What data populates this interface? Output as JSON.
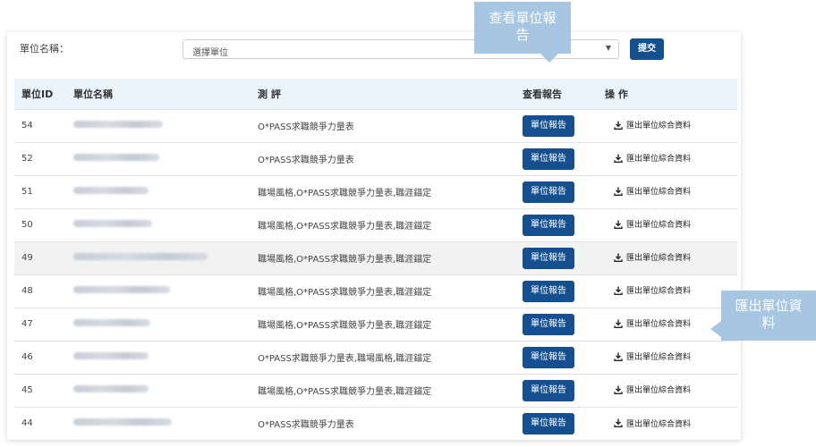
{
  "filter": {
    "label": "單位名稱：",
    "select_value": "選擇單位",
    "submit_label": "提交"
  },
  "table": {
    "headers": [
      "單位ID",
      "單位名稱",
      "測 評",
      "查看報告",
      "操 作"
    ],
    "report_label": "單位報告",
    "export_label": "匯出單位綜合資料",
    "rows": [
      {
        "id": "54",
        "evaluation": "O*PASS求職競爭力量表"
      },
      {
        "id": "52",
        "evaluation": "O*PASS求職競爭力量表"
      },
      {
        "id": "51",
        "evaluation": "職場風格,O*PASS求職競爭力量表,職涯錨定"
      },
      {
        "id": "50",
        "evaluation": "職場風格,O*PASS求職競爭力量表,職涯錨定"
      },
      {
        "id": "49",
        "evaluation": "職場風格,O*PASS求職競爭力量表,職涯錨定"
      },
      {
        "id": "48",
        "evaluation": "職場風格,O*PASS求職競爭力量表,職涯錨定"
      },
      {
        "id": "47",
        "evaluation": "職場風格,O*PASS求職競爭力量表,職涯錨定"
      },
      {
        "id": "46",
        "evaluation": "O*PASS求職競爭力量表,職場風格,職涯錨定"
      },
      {
        "id": "45",
        "evaluation": "職場風格,O*PASS求職競爭力量表,職涯錨定"
      },
      {
        "id": "44",
        "evaluation": "O*PASS求職競爭力量表"
      }
    ]
  },
  "callouts": {
    "view_report": "查看單位報告",
    "export_data": "匯出單位資料"
  },
  "colors": {
    "primary_button": "#14508f",
    "header_bg": "#e9f3fb",
    "callout_bg": "#9ec1de"
  },
  "icons": {
    "export": "download-icon",
    "select": "chevron-down-icon"
  }
}
